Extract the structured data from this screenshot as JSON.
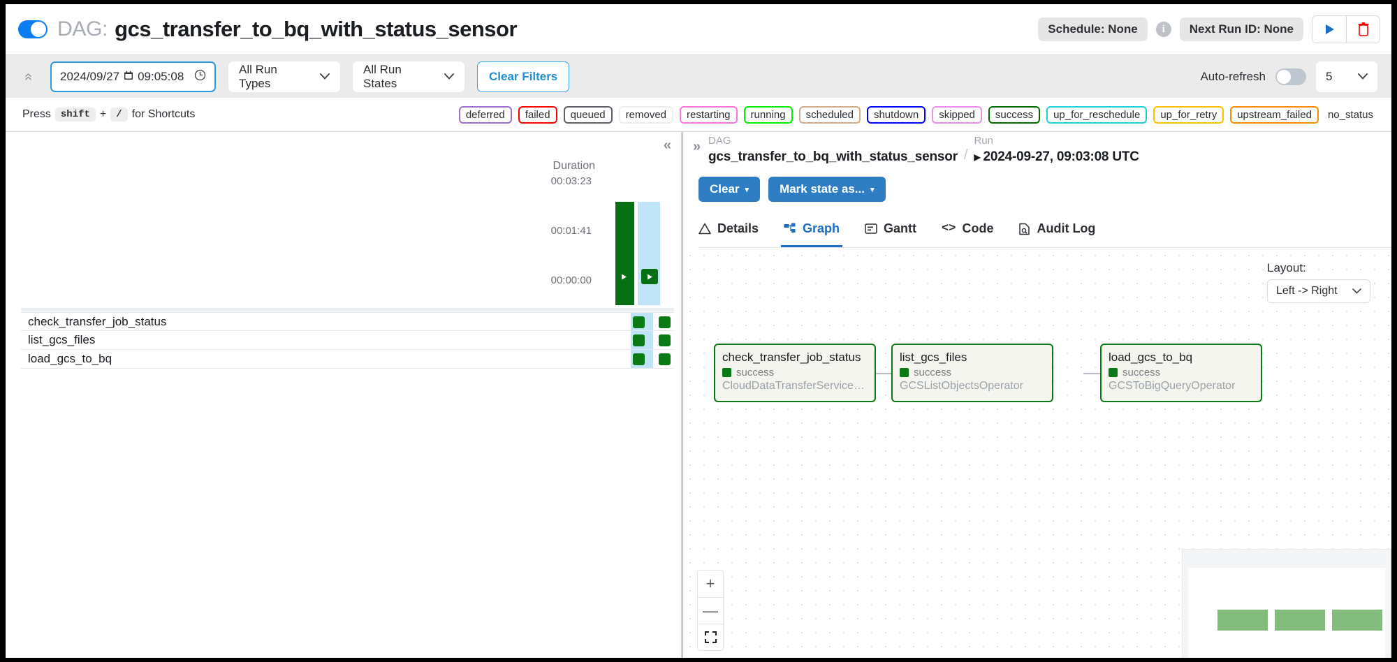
{
  "header": {
    "toggle_name": "dag-pause-toggle",
    "dag_kicker": "DAG:",
    "dag_name": "gcs_transfer_to_bq_with_status_sensor",
    "schedule_pill": "Schedule: None",
    "info_glyph": "i",
    "next_run_pill": "Next Run ID: None",
    "trigger_glyph": "▶",
    "delete_glyph": "🗑"
  },
  "filters": {
    "collapse_glyph": "«",
    "date_value": "2024/09/27",
    "calendar_glyph": "📅",
    "time_value": "09:05:08",
    "clock_glyph": "🕓",
    "run_types": "All Run Types",
    "run_states": "All Run States",
    "chevron_glyph": "⌄",
    "clear_filters": "Clear Filters",
    "auto_refresh_label": "Auto-refresh",
    "refresh_interval": "5"
  },
  "legend": {
    "press_text": "Press",
    "key_shift": "shift",
    "plus": "+",
    "key_slash": "/",
    "for_text": "for Shortcuts",
    "states": [
      {
        "label": "deferred",
        "color": "#9b6fd4"
      },
      {
        "label": "failed",
        "color": "#fe0000"
      },
      {
        "label": "queued",
        "color": "#5c6068"
      },
      {
        "label": "removed",
        "color": "#eeeeee"
      },
      {
        "label": "restarting",
        "color": "#fc77d9"
      },
      {
        "label": "running",
        "color": "#00ef00"
      },
      {
        "label": "scheduled",
        "color": "#d3ac8b"
      },
      {
        "label": "shutdown",
        "color": "#0000ff"
      },
      {
        "label": "skipped",
        "color": "#eb8fea"
      },
      {
        "label": "success",
        "color": "#046b04"
      },
      {
        "label": "up_for_reschedule",
        "color": "#1ed3d3"
      },
      {
        "label": "up_for_retry",
        "color": "#fdc300"
      },
      {
        "label": "upstream_failed",
        "color": "#fb8c00"
      }
    ],
    "no_status": "no_status"
  },
  "grid": {
    "collapse_glyph": "«",
    "duration_title": "Duration",
    "axis_ticks": [
      "00:03:23",
      "00:01:41",
      "00:00:00"
    ],
    "run_glyph": "▶",
    "tasks": [
      {
        "name": "check_transfer_job_status",
        "states": [
          "success",
          "success"
        ]
      },
      {
        "name": "list_gcs_files",
        "states": [
          "success",
          "success"
        ]
      },
      {
        "name": "load_gcs_to_bq",
        "states": [
          "success",
          "success"
        ]
      }
    ]
  },
  "detail": {
    "expand_glyph": "»",
    "dag_kicker": "DAG",
    "dag_value": "gcs_transfer_to_bq_with_status_sensor",
    "separator": "/",
    "run_kicker": "Run",
    "run_triangle": "▶",
    "run_value": "2024-09-27, 09:03:08 UTC",
    "clear_button": "Clear",
    "mark_state_button": "Mark state as...",
    "caret_glyph": "▾",
    "tabs": [
      {
        "label": "Details",
        "icon": "⚠",
        "active": false
      },
      {
        "label": "Graph",
        "icon": "⛓",
        "active": true
      },
      {
        "label": "Gantt",
        "icon": "☰",
        "active": false
      },
      {
        "label": "Code",
        "icon": "<>",
        "active": false
      },
      {
        "label": "Audit Log",
        "icon": "📄",
        "active": false
      }
    ]
  },
  "graph": {
    "layout_label": "Layout:",
    "layout_value": "Left -> Right",
    "chevron_glyph": "⌄",
    "nodes": [
      {
        "title": "check_transfer_job_status",
        "state": "success",
        "operator": "CloudDataTransferServiceJobSt…"
      },
      {
        "title": "list_gcs_files",
        "state": "success",
        "operator": "GCSListObjectsOperator"
      },
      {
        "title": "load_gcs_to_bq",
        "state": "success",
        "operator": "GCSToBigQueryOperator"
      }
    ],
    "zoom_in_glyph": "+",
    "zoom_out_glyph": "—",
    "fit_glyph": "⬚",
    "success_color": "#0a7a17",
    "node_fill": "#f4f5ef",
    "minimap_node_color": "#82bb7c"
  }
}
